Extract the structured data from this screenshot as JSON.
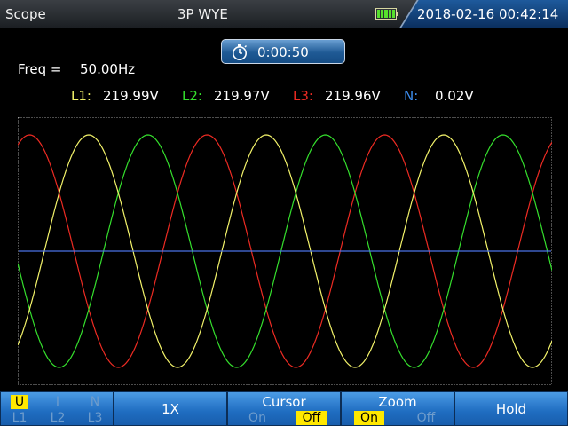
{
  "header": {
    "title": "Scope",
    "mode": "3P WYE",
    "datetime": "2018-02-16 00:42:14",
    "battery_icon": "battery-full-icon"
  },
  "timer": {
    "icon": "stopwatch-icon",
    "value": "0:00:50"
  },
  "measurements": {
    "freq_label": "Freq =",
    "freq_value": "50.00Hz",
    "phases": [
      {
        "label": "L1:",
        "value": "219.99V",
        "color": "#f3f36a"
      },
      {
        "label": "L2:",
        "value": "219.97V",
        "color": "#35e02d"
      },
      {
        "label": "L3:",
        "value": "219.96V",
        "color": "#ee2b23"
      },
      {
        "label": "N:",
        "value": "0.02V",
        "color": "#3d8ef0"
      }
    ]
  },
  "colors": {
    "L1": "#f3f36a",
    "L2": "#35e02d",
    "L3": "#ee2b23",
    "N": "#4a72e6",
    "softkey_selected": "#ffe800"
  },
  "softkeys": {
    "select": {
      "top": [
        "U",
        "I",
        "N"
      ],
      "bottom": [
        "L1",
        "L2",
        "L3"
      ],
      "selected": "U"
    },
    "scale": {
      "label": "1X"
    },
    "cursor": {
      "label": "Cursor",
      "on": "On",
      "off": "Off",
      "selected": "Off"
    },
    "zoom": {
      "label": "Zoom",
      "on": "On",
      "off": "Off",
      "selected": "On"
    },
    "hold": {
      "label": "Hold"
    }
  }
}
